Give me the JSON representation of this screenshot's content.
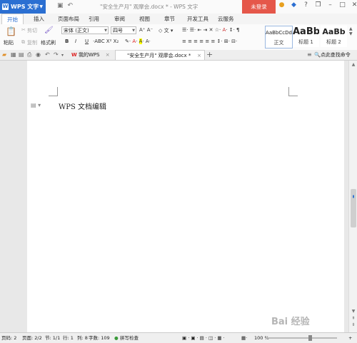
{
  "titlebar": {
    "app_label": "WPS 文字",
    "doc_title": "\"安全生产月\" 观摩会.docx * - WPS 文字",
    "login_label": "未登录"
  },
  "menu": [
    "开始",
    "插入",
    "页面布局",
    "引用",
    "审阅",
    "视图",
    "章节",
    "开发工具",
    "云服务"
  ],
  "ribbon": {
    "paste": "粘贴",
    "cut": "剪切",
    "copy": "复制",
    "format_painter": "格式刷",
    "font_name": "宋体 (正文)",
    "font_size": "四号",
    "bold": "B",
    "italic": "I",
    "underline": "U",
    "styles": [
      {
        "preview": "AaBbCcDd",
        "label": "正文"
      },
      {
        "preview": "AaBb",
        "label": "标题 1"
      },
      {
        "preview": "AaBb",
        "label": "标题 2"
      }
    ]
  },
  "tabs": {
    "home_tab": "我的WPS",
    "doc_tab": "\"安全生产月\" 观摩会.docx *",
    "find_command": "点此查找命令"
  },
  "document": {
    "text": "WPS 文档编辑"
  },
  "status": {
    "page": "页码: 2",
    "pages": "页面: 2/2",
    "section": "节: 1/1",
    "row": "行: 1",
    "col": "列: 8",
    "words": "字数: 109",
    "spell": "拼写检查",
    "zoom": "100 %"
  },
  "watermark": "Bai 经验"
}
